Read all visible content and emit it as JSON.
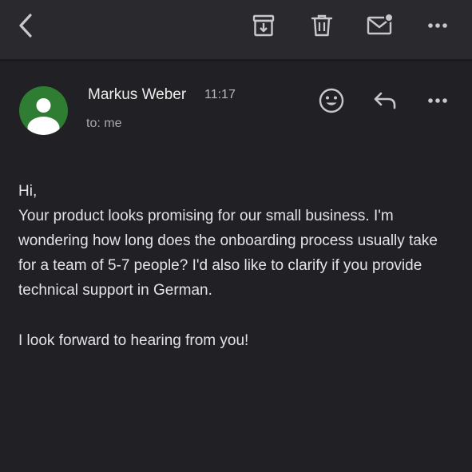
{
  "toolbar": {
    "icons": {
      "back": "chevron-left-icon",
      "archive": "archive-icon",
      "delete": "trash-icon",
      "mark_unread": "mail-unread-icon",
      "more": "more-horizontal-icon"
    }
  },
  "message": {
    "sender_name": "Markus Weber",
    "time": "11:17",
    "to_line": "to: me",
    "icons": {
      "react": "emoji-react-icon",
      "reply": "reply-icon",
      "more": "more-horizontal-icon"
    },
    "body": {
      "greeting": "Hi,",
      "paragraph": "Your product looks promising for our small business. I'm wondering how long does the onboarding process usually take for a team of 5-7 people? I'd also like to clarify if you provide technical support in German.",
      "closing": "I look forward to hearing from you!"
    }
  },
  "colors": {
    "background": "#212125",
    "toolbar": "#2a2a2e",
    "avatar": "#2e7d32",
    "icon": "#c8c8cc",
    "text": "#e4e4e7",
    "muted_text": "#a9a9ae"
  }
}
